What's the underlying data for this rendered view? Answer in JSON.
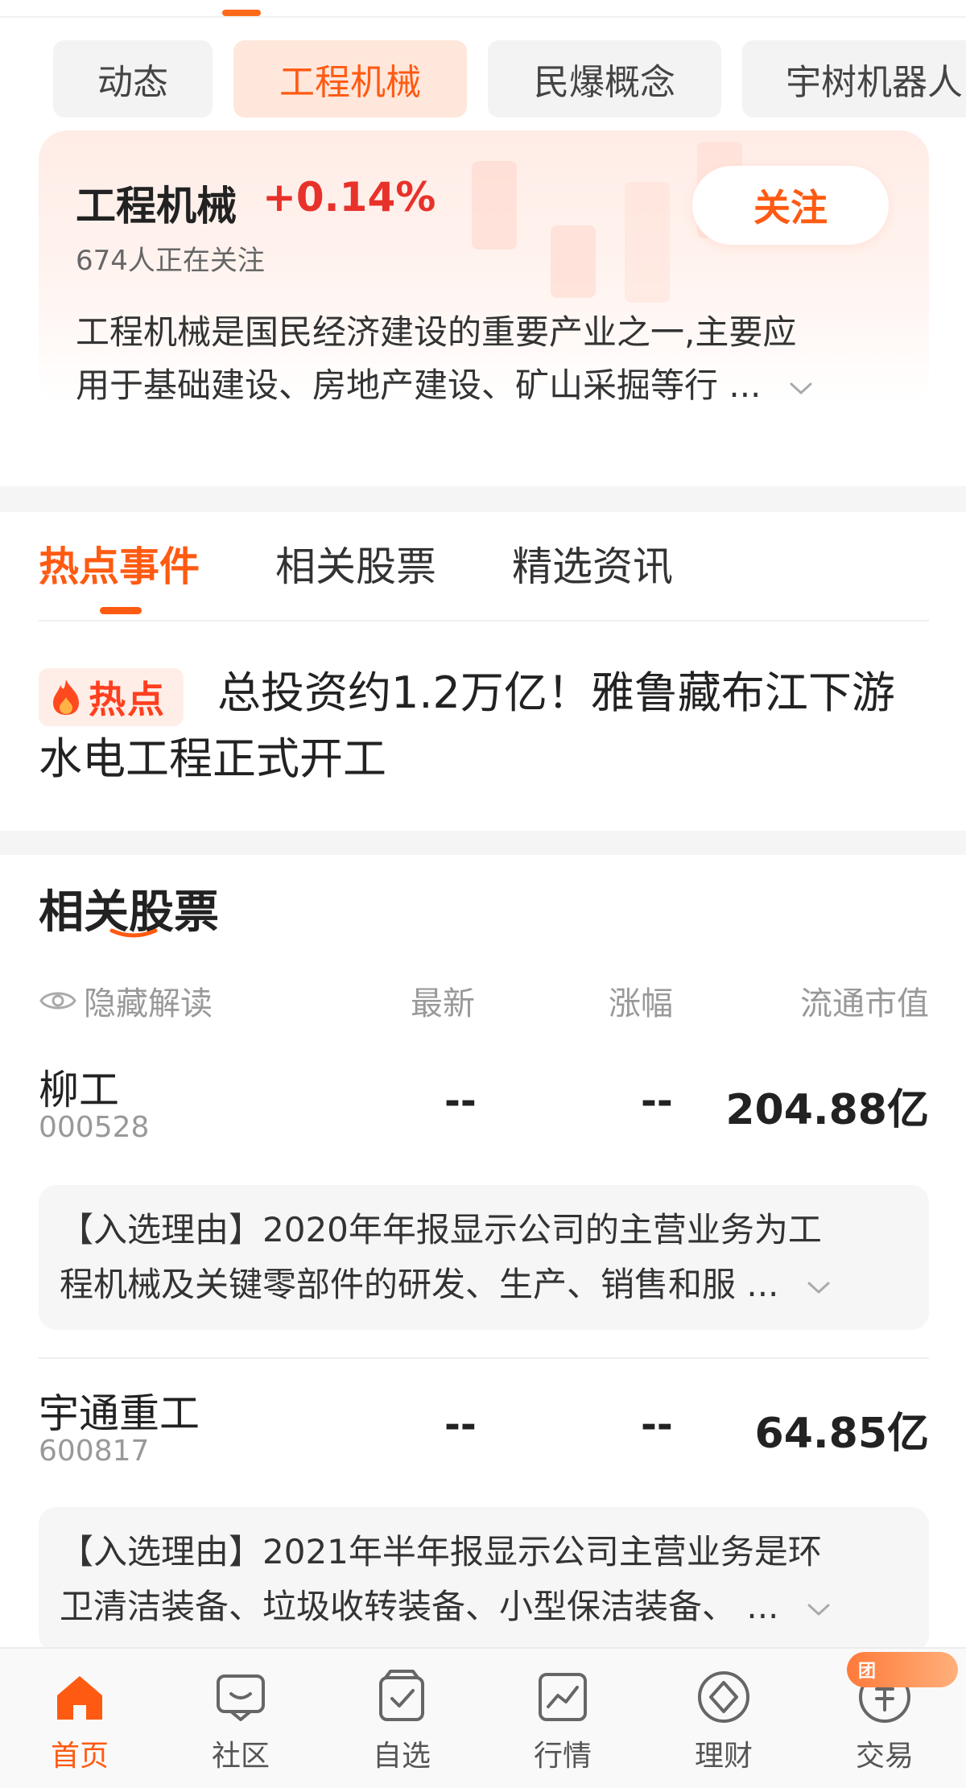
{
  "colors": {
    "accent": "#ff5a12",
    "rise": "#e8312b",
    "text": "#222222",
    "muted": "#999999"
  },
  "chips": [
    {
      "label": "动态",
      "active": false
    },
    {
      "label": "工程机械",
      "active": true
    },
    {
      "label": "民爆概念",
      "active": false
    },
    {
      "label": "宇树机器人",
      "active": false
    }
  ],
  "concept": {
    "title": "工程机械",
    "change": "+0.14%",
    "watchers": "674人正在关注",
    "follow_label": "关注",
    "description_lines": [
      "工程机械是国民经济建设的重要产业之一,主要应",
      "用于基础建设、房地产建设、矿山采掘等行 ..."
    ]
  },
  "section_tabs": [
    "热点事件",
    "相关股票",
    "精选资讯"
  ],
  "hot": {
    "badge": "热点",
    "title": "总投资约1.2万亿！雅鲁藏布江下游水电工程正式开工"
  },
  "related": {
    "title": "相关股票",
    "hide_label": "隐藏解读",
    "columns": [
      "最新",
      "涨幅",
      "流通市值"
    ],
    "stocks": [
      {
        "name": "柳工",
        "code": "000528",
        "latest": "--",
        "change": "--",
        "cap": "204.88亿",
        "reason_lines": [
          "【入选理由】2020年年报显示公司的主营业务为工",
          "程机械及关键零部件的研发、生产、销售和服 ..."
        ]
      },
      {
        "name": "宇通重工",
        "code": "600817",
        "latest": "--",
        "change": "--",
        "cap": "64.85亿",
        "reason_lines": [
          "【入选理由】2021年半年报显示公司主营业务是环",
          "卫清洁装备、垃圾收转装备、小型保洁装备、 ..."
        ]
      }
    ]
  },
  "bottom_nav": [
    {
      "label": "首页",
      "icon": "home-icon",
      "active": true
    },
    {
      "label": "社区",
      "icon": "community-icon",
      "active": false
    },
    {
      "label": "自选",
      "icon": "watchlist-icon",
      "active": false
    },
    {
      "label": "行情",
      "icon": "market-icon",
      "active": false
    },
    {
      "label": "理财",
      "icon": "wealth-icon",
      "active": false
    },
    {
      "label": "交易",
      "icon": "trade-icon",
      "active": false
    }
  ],
  "trade_badge": "团"
}
